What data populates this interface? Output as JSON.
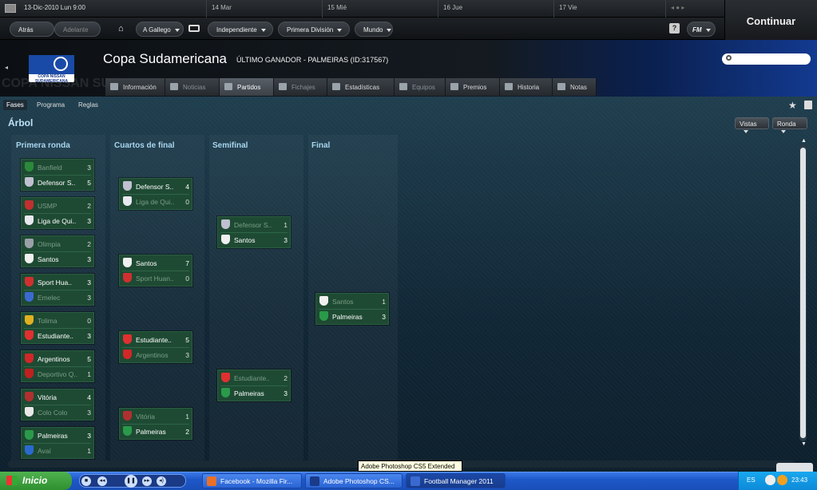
{
  "topbar": {
    "date": "13-Dic-2010 Lun 9:00",
    "days": [
      "14 Mar",
      "15 Mié",
      "16 Jue",
      "17 Vie"
    ]
  },
  "nav": {
    "back": "Atrás",
    "forward": "Adelante",
    "manager": "A Gallego",
    "country": "Independiente",
    "division": "Primera División",
    "world": "Mundo",
    "help": "?",
    "fm": "FM",
    "continue": "Continuar"
  },
  "header": {
    "logo_text": "COPA NISSAN SUDAMERICANA",
    "title": "Copa Sudamericana",
    "subtitle": "ÚLTIMO GANADOR - PALMEIRAS (ID:317567)",
    "watermark": "COPA NISSAN SUDAMERICANA"
  },
  "tabs": [
    {
      "label": "Información",
      "state": "normal"
    },
    {
      "label": "Noticias",
      "state": "dim"
    },
    {
      "label": "Partidos",
      "state": "active"
    },
    {
      "label": "Fichajes",
      "state": "dim"
    },
    {
      "label": "Estadísticas",
      "state": "normal"
    },
    {
      "label": "Equipos",
      "state": "dim"
    },
    {
      "label": "Premios",
      "state": "normal"
    },
    {
      "label": "Historia",
      "state": "normal"
    },
    {
      "label": "Notas",
      "state": "normal"
    }
  ],
  "subtabs": [
    "Fases",
    "Programa",
    "Reglas"
  ],
  "section_title": "Árbol",
  "right_buttons": {
    "views": "Vistas",
    "round": "Ronda"
  },
  "columns": [
    "Primera ronda",
    "Cuartos de final",
    "Semifinal",
    "Final"
  ],
  "rounds": [
    [
      {
        "home": {
          "name": "Banfield",
          "score": "3",
          "win": false,
          "crest": "#2a8a3a"
        },
        "away": {
          "name": "Defensor S..",
          "score": "5",
          "win": true,
          "crest": "#c0c0d0"
        }
      },
      {
        "home": {
          "name": "USMP",
          "score": "2",
          "win": false,
          "crest": "#c03030"
        },
        "away": {
          "name": "Liga de Qui..",
          "score": "3",
          "win": true,
          "crest": "#e8e8f0"
        }
      },
      {
        "home": {
          "name": "Olimpia",
          "score": "2",
          "win": false,
          "crest": "#9aa0a8"
        },
        "away": {
          "name": "Santos",
          "score": "3",
          "win": true,
          "crest": "#f0f0f0"
        }
      },
      {
        "home": {
          "name": "Sport Hua..",
          "score": "3",
          "win": true,
          "crest": "#d03030"
        },
        "away": {
          "name": "Emelec",
          "score": "3",
          "win": false,
          "crest": "#3a6ad0"
        }
      },
      {
        "home": {
          "name": "Tolima",
          "score": "0",
          "win": false,
          "crest": "#e0b020"
        },
        "away": {
          "name": "Estudiante..",
          "score": "3",
          "win": true,
          "crest": "#e03030"
        }
      },
      {
        "home": {
          "name": "Argentinos",
          "score": "5",
          "win": true,
          "crest": "#d02828"
        },
        "away": {
          "name": "Deportivo Q..",
          "score": "1",
          "win": false,
          "crest": "#c02020"
        }
      },
      {
        "home": {
          "name": "Vitória",
          "score": "4",
          "win": true,
          "crest": "#b03030"
        },
        "away": {
          "name": "Colo Colo",
          "score": "3",
          "win": false,
          "crest": "#e8e8e8"
        }
      },
      {
        "home": {
          "name": "Palmeiras",
          "score": "3",
          "win": true,
          "crest": "#2a9a4a"
        },
        "away": {
          "name": "Avaí",
          "score": "1",
          "win": false,
          "crest": "#2a6ad0"
        }
      }
    ],
    [
      {
        "home": {
          "name": "Defensor S..",
          "score": "4",
          "win": true,
          "crest": "#c0c0d0"
        },
        "away": {
          "name": "Liga de Qui..",
          "score": "0",
          "win": false,
          "crest": "#e8e8f0"
        }
      },
      {
        "home": {
          "name": "Santos",
          "score": "7",
          "win": true,
          "crest": "#f0f0f0"
        },
        "away": {
          "name": "Sport Huan..",
          "score": "0",
          "win": false,
          "crest": "#d03030"
        }
      },
      {
        "home": {
          "name": "Estudiante..",
          "score": "5",
          "win": true,
          "crest": "#e03030"
        },
        "away": {
          "name": "Argentinos",
          "score": "3",
          "win": false,
          "crest": "#d02828"
        }
      },
      {
        "home": {
          "name": "Vitória",
          "score": "1",
          "win": false,
          "crest": "#b03030"
        },
        "away": {
          "name": "Palmeiras",
          "score": "2",
          "win": true,
          "crest": "#2a9a4a"
        }
      }
    ],
    [
      {
        "home": {
          "name": "Defensor S..",
          "score": "1",
          "win": false,
          "crest": "#c0c0d0"
        },
        "away": {
          "name": "Santos",
          "score": "3",
          "win": true,
          "crest": "#f0f0f0"
        }
      },
      {
        "home": {
          "name": "Estudiante..",
          "score": "2",
          "win": false,
          "crest": "#e03030"
        },
        "away": {
          "name": "Palmeiras",
          "score": "3",
          "win": true,
          "crest": "#2a9a4a"
        }
      }
    ],
    [
      {
        "home": {
          "name": "Santos",
          "score": "1",
          "win": false,
          "crest": "#f0f0f0"
        },
        "away": {
          "name": "Palmeiras",
          "score": "3",
          "win": true,
          "crest": "#2a9a4a"
        }
      }
    ]
  ],
  "tooltip": "Adobe Photoshop CS5 Extended",
  "taskbar": {
    "start": "Inicio",
    "tasks": [
      {
        "label": "Facebook - Mozilla Fir...",
        "color": "#e8702a",
        "active": false
      },
      {
        "label": "Adobe Photoshop CS...",
        "color": "#1a3a8a",
        "active": false
      },
      {
        "label": "Football Manager 2011",
        "color": "#3a6ad0",
        "active": true
      }
    ],
    "lang": "ES",
    "clock": "23:43"
  }
}
